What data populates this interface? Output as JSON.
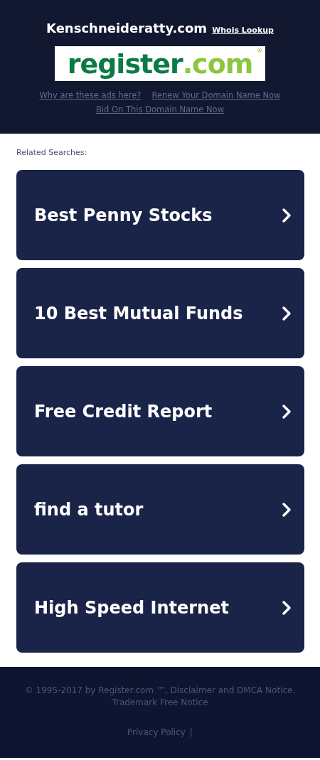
{
  "header": {
    "domain": "Kenschneideratty.com",
    "whois_link": "Whois Lookup",
    "logo": {
      "name": "register",
      "suffix": ".com",
      "mark": "®"
    },
    "links": [
      "Why are these ads here?",
      "Renew Your Domain Name Now",
      "Bid On This Domain Name Now"
    ]
  },
  "related": {
    "title": "Related Searches:",
    "items": [
      "Best Penny Stocks",
      "10 Best Mutual Funds",
      "Free Credit Report",
      "find a tutor",
      "High Speed Internet"
    ]
  },
  "footer": {
    "copyright": "© 1995-2017 by Register.com ™, Disclaimer and DMCA Notice. Trademark Free Notice",
    "privacy": "Privacy Policy",
    "separator": "|"
  }
}
